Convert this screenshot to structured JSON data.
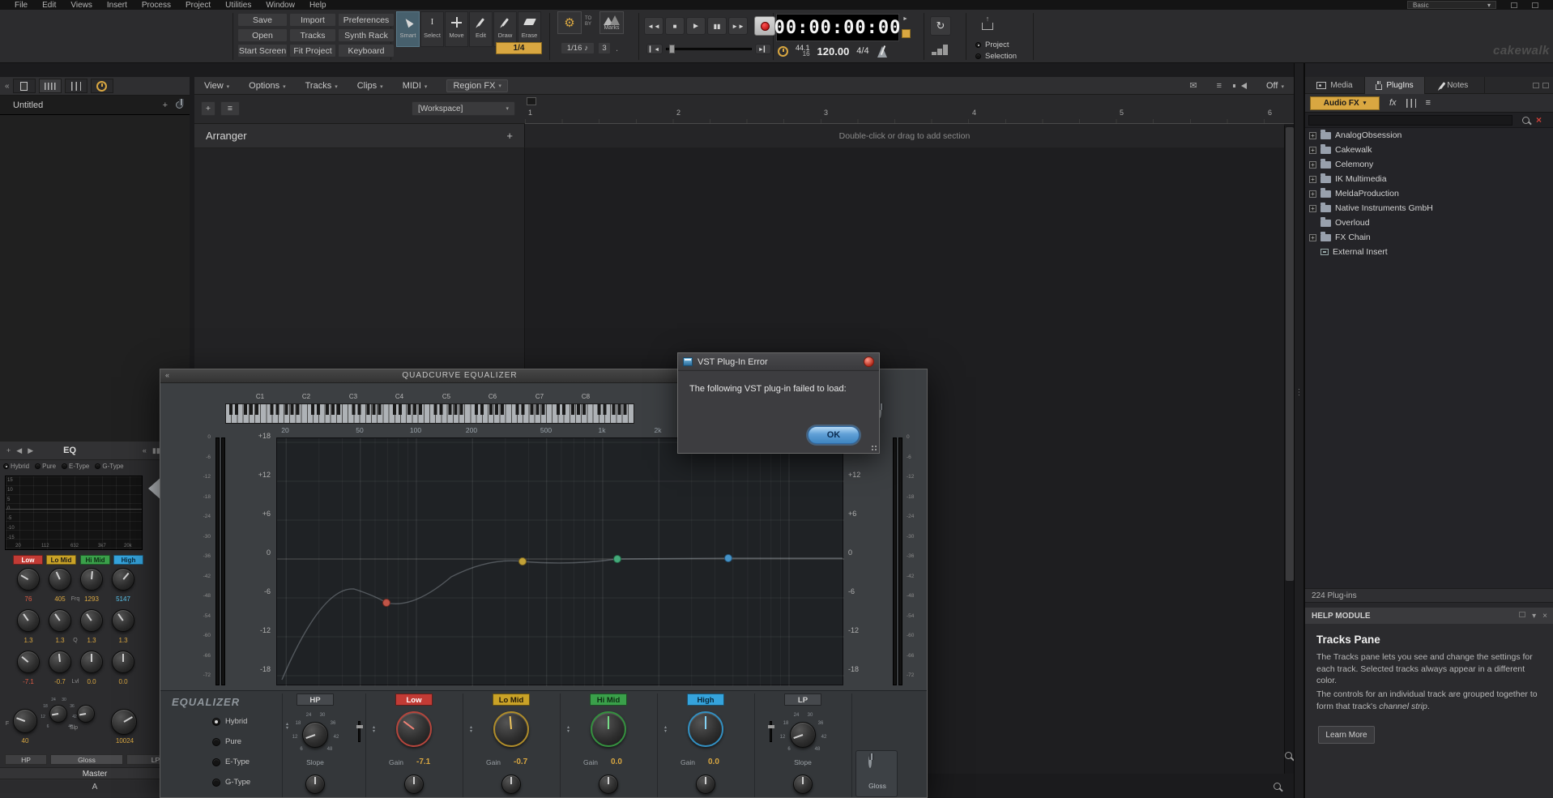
{
  "icons": {
    "caret": "▾",
    "plus": "+",
    "close": "×",
    "chevrons_left": "«",
    "left": "◀",
    "right": "▶",
    "rewind": "◄◄",
    "stop": "■",
    "play": "►",
    "pause": "▮▮",
    "forward": "►►",
    "go_start": "▎◄",
    "go_end": "►▎",
    "gear": "⚙",
    "note": "♪",
    "menu": "≡",
    "envelope": "✉",
    "loop": "↻",
    "ibeam": "I",
    "up": "▴",
    "down": "▾",
    "arrow_up": "↑",
    "grip": "⋮",
    "fx": "fx"
  },
  "menubar": {
    "items": [
      "File",
      "Edit",
      "Views",
      "Insert",
      "Process",
      "Project",
      "Utilities",
      "Window",
      "Help"
    ],
    "workspace_preset": "Basic"
  },
  "toolbar": {
    "buttons": [
      "Save",
      "Import",
      "Preferences",
      "Open",
      "Tracks",
      "Synth Rack",
      "Start Screen",
      "Fit Project",
      "Keyboard"
    ],
    "tools": [
      "Smart",
      "Select",
      "Move",
      "Edit",
      "Draw",
      "Erase"
    ],
    "snap": {
      "to": "TO",
      "by": "BY",
      "marks": "Marks",
      "duration": "1/4",
      "resolution": "1/16",
      "count": "3",
      "dot": "."
    },
    "time_display": "00:00:00:00",
    "sample_rate": "44.1",
    "bit_depth": "16",
    "tempo": "120.00",
    "time_signature": "4/4",
    "record_scope": {
      "project": "Project",
      "selection": "Selection"
    },
    "brand": "cakewalk"
  },
  "left_panel": {
    "track_name": "Untitled",
    "prochannel": {
      "title": "EQ",
      "modes": [
        "Hybrid",
        "Pure",
        "E-Type",
        "G-Type"
      ],
      "graph_db_labels": [
        "15",
        "10",
        "5",
        "0",
        "-5",
        "-10",
        "-15"
      ],
      "graph_freq_labels": [
        "20",
        "112",
        "632",
        "3k7",
        "20k"
      ],
      "bands": [
        {
          "name": "Low",
          "freq": "76",
          "q": "1.3",
          "level": "-7.1"
        },
        {
          "name": "Lo Mid",
          "freq": "405",
          "q": "1.3",
          "level": "-0.7"
        },
        {
          "name": "Hi Mid",
          "freq": "1293",
          "q": "1.3",
          "level": "0.0"
        },
        {
          "name": "High",
          "freq": "5147",
          "q": "1.3",
          "level": "0.0"
        }
      ],
      "param_labels": {
        "freq": "Frq",
        "q": "Q",
        "level": "Lvl",
        "filter": "F",
        "slope": "Slp"
      },
      "hp_freq": "40",
      "lp_freq": "10024",
      "footer_buttons": [
        "HP",
        "Gloss",
        "LP"
      ]
    },
    "master_label": "Master",
    "interleave_label": "A"
  },
  "center": {
    "menus": [
      "View",
      "Options",
      "Tracks",
      "Clips",
      "MIDI",
      "Region FX"
    ],
    "mute_label": "Off",
    "workspace_selector": "[Workspace]",
    "arranger_title": "Arranger",
    "ruler_numbers": [
      "1",
      "2",
      "3",
      "4",
      "5",
      "6"
    ],
    "empty_hint": "Double-click or drag to add section"
  },
  "browser": {
    "tabs": [
      "Media",
      "PlugIns",
      "Notes"
    ],
    "category": "Audio FX",
    "tree": [
      {
        "label": "AnalogObsession"
      },
      {
        "label": "Cakewalk"
      },
      {
        "label": "Celemony"
      },
      {
        "label": "IK Multimedia"
      },
      {
        "label": "MeldaProduction"
      },
      {
        "label": "Native Instruments GmbH"
      },
      {
        "label": "Overloud"
      },
      {
        "label": "FX Chain"
      },
      {
        "label": "External Insert"
      }
    ],
    "status": "224 Plug-ins"
  },
  "help_module": {
    "title": "HELP MODULE",
    "heading": "Tracks Pane",
    "paragraph1": "The Tracks pane lets you see and change the settings for each track. Selected tracks always appear in a different color.",
    "paragraph2_before": "The controls for an individual track are grouped together to form that track's ",
    "paragraph2_emphasis": "channel strip",
    "paragraph2_after": ".",
    "learn_more": "Learn More"
  },
  "eq_window": {
    "title": "QUADCURVE EQUALIZER",
    "octave_labels": [
      "C1",
      "C2",
      "C3",
      "C4",
      "C5",
      "C6",
      "C7",
      "C8"
    ],
    "freq_labels": [
      "20",
      "50",
      "100",
      "200",
      "500",
      "1k",
      "2k"
    ],
    "db_labels": [
      "+18",
      "+12",
      "+6",
      "0",
      "-6",
      "-12",
      "-18"
    ],
    "meter_labels": [
      "0",
      "-6",
      "-12",
      "-18",
      "-24",
      "-30",
      "-36",
      "-42",
      "-48",
      "-54",
      "-60",
      "-66",
      "-72"
    ],
    "brand": "EQUALIZER",
    "modes": [
      "Hybrid",
      "Pure",
      "E-Type",
      "G-Type"
    ],
    "bands": [
      {
        "name": "HP",
        "param": "Slope",
        "value": ""
      },
      {
        "name": "Low",
        "param": "Gain",
        "value": "-7.1"
      },
      {
        "name": "Lo Mid",
        "param": "Gain",
        "value": "-0.7"
      },
      {
        "name": "Hi Mid",
        "param": "Gain",
        "value": "0.0"
      },
      {
        "name": "High",
        "param": "Gain",
        "value": "0.0"
      },
      {
        "name": "LP",
        "param": "Slope",
        "value": ""
      }
    ],
    "slope_ticks": [
      "6",
      "12",
      "18",
      "24",
      "30",
      "36",
      "42",
      "48"
    ],
    "gloss_label": "Gloss"
  },
  "error_dialog": {
    "title": "VST Plug-In Error",
    "message": "The following VST plug-in failed to load:",
    "ok_label": "OK"
  },
  "colors": {
    "accent": "#d9a741",
    "band_low": "#c23b35",
    "band_lo_mid": "#c9a227",
    "band_hi_mid": "#3aa04a",
    "band_high": "#35a3dc",
    "error": "#c03535",
    "ok_button": "#5a9bd5"
  }
}
